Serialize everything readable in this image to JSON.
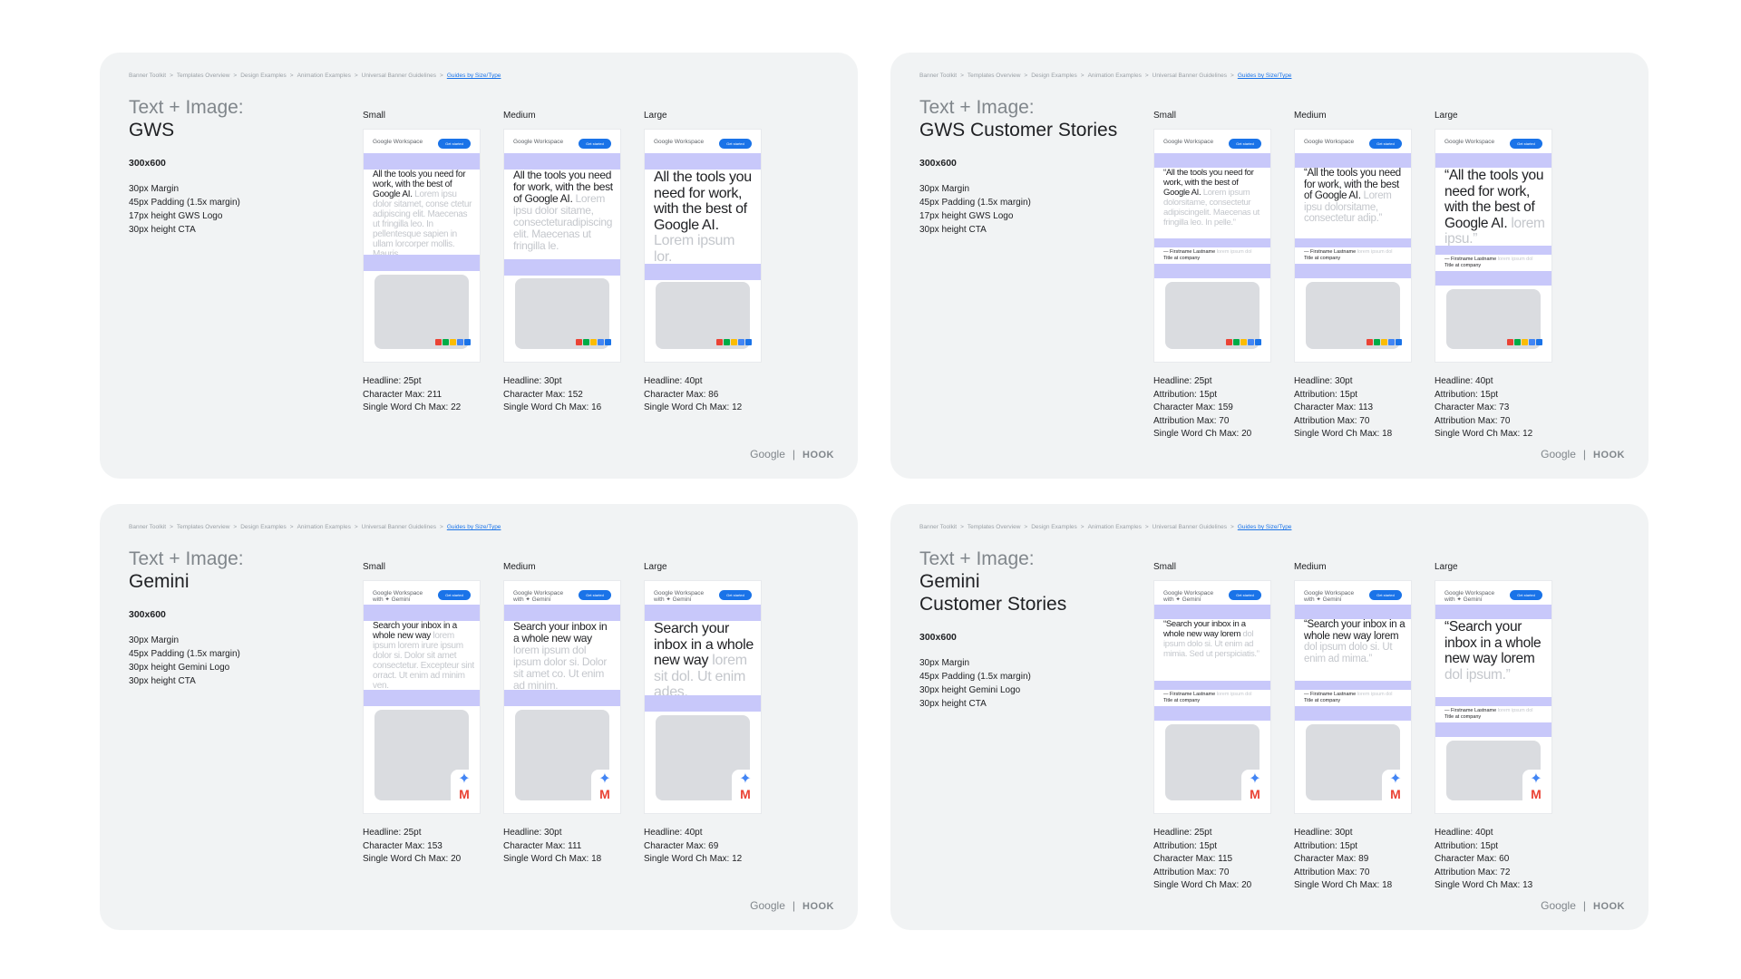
{
  "breadcrumb": [
    "Banner Toolkit",
    "Templates Overview",
    "Design Examples",
    "Animation Examples",
    "Universal Banner Guidelines",
    "Guides by Size/Type"
  ],
  "breadcrumb_separator": ">",
  "brand": {
    "google": "Google",
    "divider": "|",
    "hook": "HOOK"
  },
  "colors": {
    "band": "#c8c8fa",
    "cta": "#1a73e8",
    "panel": "#f1f3f4",
    "accent_link": "#1a73e8"
  },
  "panels": [
    {
      "title_prefix": "Text + Image:",
      "title": "GWS",
      "size": "300x600",
      "specs": [
        "30px Margin",
        "45px Padding (1.5x margin)",
        "17px height GWS Logo",
        "30px height CTA"
      ],
      "columns": [
        {
          "label": "Small",
          "headline": "All the tools you need for work, with the best of Google AI.",
          "filler": " Lorem ipsu dolor sitamet, conse ctetur adipiscing elit. Maecenas ut fringilla leo. In pellentesque sapien in ullam lorcorper mollis. Mauris.",
          "metrics": [
            "Headline: 25pt",
            "Character Max: 211",
            "Single Word Ch Max: 22"
          ]
        },
        {
          "label": "Medium",
          "headline": "All the tools you need for work, with the best of Google AI.",
          "filler": " Lorem ipsu dolor sitame, consecteturadipiscing elit. Maecenas ut fringilla le.",
          "metrics": [
            "Headline: 30pt",
            "Character Max: 152",
            "Single Word Ch Max: 16"
          ]
        },
        {
          "label": "Large",
          "headline": "All the tools you need for work, with the best of Google AI.",
          "filler": " Lorem ipsum lor.",
          "metrics": [
            "Headline: 40pt",
            "Character Max: 86",
            "Single Word Ch Max: 12"
          ]
        }
      ]
    },
    {
      "title_prefix": "Text + Image:",
      "title": "GWS Customer Stories",
      "size": "300x600",
      "specs": [
        "30px Margin",
        "45px Padding (1.5x margin)",
        "17px height GWS Logo",
        "30px height CTA"
      ],
      "columns": [
        {
          "label": "Small",
          "headline": "“All the tools you need for work, with the best of Google AI.",
          "filler": " Lorem ipsum dolorsitame, consectetur adipiscingelit. Maecenas ut fringilla leo. In pelle.”",
          "attribution": "— Firstname Lastname",
          "attr_filler": " lorem ipsum dol",
          "attr_title": "Title at company",
          "metrics": [
            "Headline: 25pt",
            "Attribution: 15pt",
            "Character Max: 159",
            "Attribution Max: 70",
            "Single Word Ch Max: 20"
          ]
        },
        {
          "label": "Medium",
          "headline": "“All the tools you need for work, with the best of Google AI.",
          "filler": " Lorem ipsu dolorsitame, consectetur adip.”",
          "attribution": "— Firstname Lastname",
          "attr_filler": " lorem ipsum dol",
          "attr_title": "Title at company",
          "metrics": [
            "Headline: 30pt",
            "Attribution: 15pt",
            "Character Max: 113",
            "Attribution Max: 70",
            "Single Word Ch Max: 18"
          ]
        },
        {
          "label": "Large",
          "headline": "“All the tools you need for work, with the best of Google AI.",
          "filler": " lorem ipsu.”",
          "attribution": "— Firstname Lastname",
          "attr_filler": " lorem ipsum dol",
          "attr_title": "Title at company",
          "metrics": [
            "Headline: 40pt",
            "Attribution: 15pt",
            "Character Max: 73",
            "Attribution Max: 70",
            "Single Word Ch Max: 12"
          ]
        }
      ]
    },
    {
      "title_prefix": "Text + Image:",
      "title": "Gemini",
      "size": "300x600",
      "specs": [
        "30px Margin",
        "45px Padding (1.5x margin)",
        "30px height Gemini Logo",
        "30px height CTA"
      ],
      "columns": [
        {
          "label": "Small",
          "headline": "Search your inbox in a whole new way",
          "filler": " lorem ipsum lorem irure ipsum dolor si. Dolor sit amet consectetur. Excepteur sint orract. Ut enim ad minim ven.",
          "metrics": [
            "Headline: 25pt",
            "Character Max: 153",
            "Single Word Ch Max: 20"
          ]
        },
        {
          "label": "Medium",
          "headline": "Search your inbox in a whole new way",
          "filler": " lorem ipsum dol ipsum dolor si. Dolor sit amet co. Ut enim ad minim.",
          "metrics": [
            "Headline: 30pt",
            "Character Max: 111",
            "Single Word Ch Max: 18"
          ]
        },
        {
          "label": "Large",
          "headline": "Search your inbox in a whole new way",
          "filler": " lorem sit dol. Ut enim ades.",
          "metrics": [
            "Headline: 40pt",
            "Character Max: 69",
            "Single Word Ch Max: 12"
          ]
        }
      ]
    },
    {
      "title_prefix": "Text + Image:",
      "title": "Gemini\nCustomer Stories",
      "size": "300x600",
      "specs": [
        "30px Margin",
        "45px Padding (1.5x margin)",
        "30px height Gemini Logo",
        "30px height CTA"
      ],
      "columns": [
        {
          "label": "Small",
          "headline": "“Search your inbox in a whole new way lorem",
          "filler": " dol ipsum dolo si. Ut enim ad mimia. Sed ut perspiciatis.”",
          "attribution": "— Firstname Lastname",
          "attr_filler": " lorem ipsum dol",
          "attr_title": "Title at company",
          "metrics": [
            "Headline: 25pt",
            "Attribution: 15pt",
            "Character Max: 115",
            "Attribution Max: 70",
            "Single Word Ch Max: 20"
          ]
        },
        {
          "label": "Medium",
          "headline": "“Search your inbox in a whole new way lorem",
          "filler": " dol ipsum dolo si. Ut enim ad mima.”",
          "attribution": "— Firstname Lastname",
          "attr_filler": " lorem ipsum dol",
          "attr_title": "Title at company",
          "metrics": [
            "Headline: 30pt",
            "Attribution: 15pt",
            "Character Max: 89",
            "Attribution Max: 70",
            "Single Word Ch Max: 18"
          ]
        },
        {
          "label": "Large",
          "headline": "“Search your inbox in a whole new way lorem",
          "filler": " dol ipsum.”",
          "attribution": "— Firstname Lastname",
          "attr_filler": " lorem ipsum dol",
          "attr_title": "Title at company",
          "metrics": [
            "Headline: 40pt",
            "Attribution: 15pt",
            "Character Max: 60",
            "Attribution Max: 72",
            "Single Word Ch Max: 13"
          ]
        }
      ]
    }
  ],
  "card_header": {
    "gws_logo": "Google Workspace",
    "gemini_logo_line1": "Google Workspace",
    "gemini_logo_line2": "with ✦ Gemini",
    "cta": "Get started"
  },
  "icons": {
    "workspace_apps": [
      "gmail-icon",
      "meet-icon",
      "drive-icon",
      "calendar-icon",
      "docs-icon"
    ],
    "gemini": "gemini-star-icon",
    "gmail": "gmail-icon"
  }
}
